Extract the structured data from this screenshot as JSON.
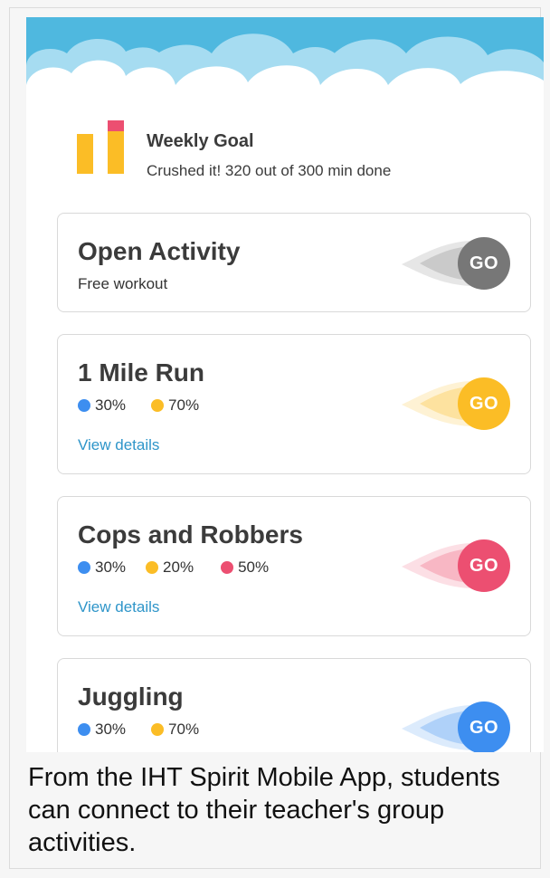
{
  "goal": {
    "title": "Weekly Goal",
    "subtitle": "Crushed it! 320 out of 300 min done",
    "progress_minutes": 320,
    "target_minutes": 300
  },
  "colors": {
    "blue": "#3d8ef0",
    "yellow": "#fbbd26",
    "red": "#ec4f71",
    "gray": "#777777",
    "link": "#2e95c9",
    "sky": "#57bfe3"
  },
  "activities": [
    {
      "title": "Open Activity",
      "subtitle": "Free workout",
      "go_label": "GO",
      "go_color": "#777777"
    },
    {
      "title": "1 Mile Run",
      "stats": [
        "30%",
        "70%"
      ],
      "view_details": "View details",
      "go_label": "GO",
      "go_color": "#fbbd26"
    },
    {
      "title": "Cops and Robbers",
      "stats": [
        "30%",
        "20%",
        "50%"
      ],
      "view_details": "View details",
      "go_label": "GO",
      "go_color": "#ec4f71"
    },
    {
      "title": "Juggling",
      "stats": [
        "30%",
        "70%"
      ],
      "go_label": "GO",
      "go_color": "#3d8ef0"
    }
  ],
  "caption": "From the IHT Spirit Mobile App, students can connect to their teacher's group activities."
}
